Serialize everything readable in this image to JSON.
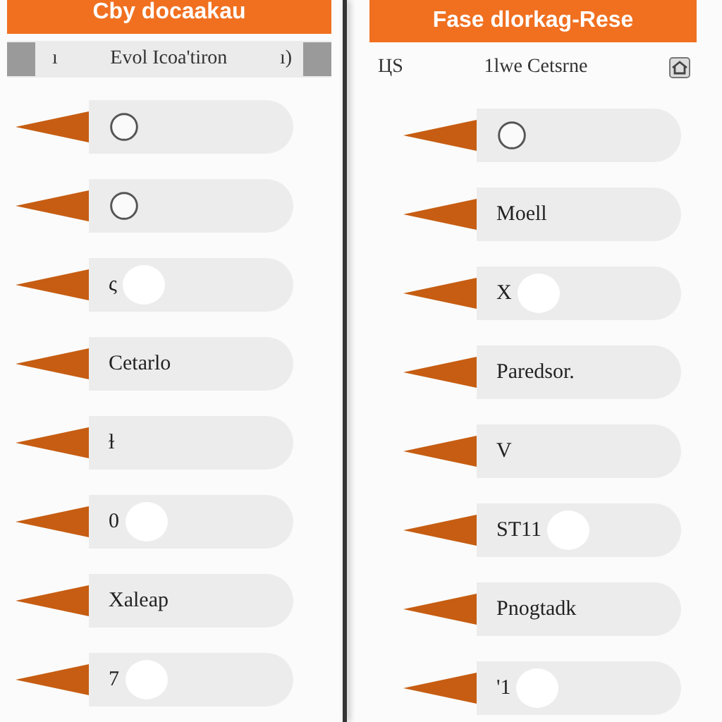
{
  "panels": [
    {
      "header": "Cby docaakau",
      "subheader": {
        "left": "ı",
        "title": "Evol Icoa'tiron",
        "right": "ı)",
        "kind": "shaded"
      },
      "rows": [
        {
          "kind": "icon"
        },
        {
          "kind": "icon"
        },
        {
          "kind": "knob",
          "text": "ς"
        },
        {
          "kind": "label",
          "text": "Cetarlo"
        },
        {
          "kind": "label",
          "text": "ɫ"
        },
        {
          "kind": "knob",
          "text": "0"
        },
        {
          "kind": "label",
          "text": "Xaleap"
        },
        {
          "kind": "knob",
          "text": "7"
        }
      ]
    },
    {
      "header": "Fase dlorkag-Rese",
      "subheader": {
        "left": "ЦЅ",
        "title": "1lwe Cetsrne",
        "kind": "plain"
      },
      "rows": [
        {
          "kind": "icon"
        },
        {
          "kind": "label",
          "text": "Moell"
        },
        {
          "kind": "knob",
          "text": "X"
        },
        {
          "kind": "label",
          "text": "Paredsor."
        },
        {
          "kind": "label",
          "text": "V"
        },
        {
          "kind": "knob",
          "text": "ST11"
        },
        {
          "kind": "label",
          "text": "Pnogtadk"
        },
        {
          "kind": "knob",
          "text": "'1"
        }
      ]
    }
  ]
}
